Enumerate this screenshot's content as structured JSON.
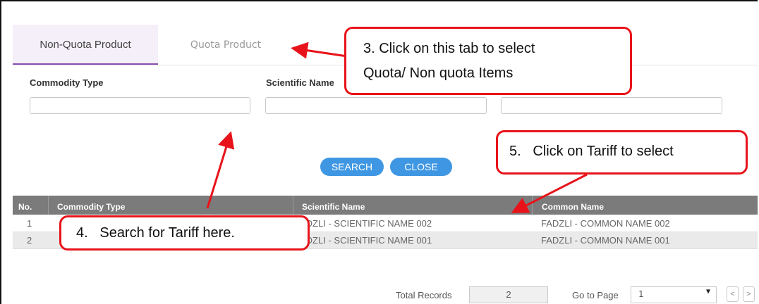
{
  "tabs": [
    {
      "label": "Non-Quota Product",
      "active": true
    },
    {
      "label": "Quota Product",
      "active": false
    }
  ],
  "filters": {
    "commodity_type_label": "Commodity Type",
    "scientific_name_label": "Scientific Name",
    "commodity_type_value": "",
    "scientific_name_value": "",
    "common_name_value": ""
  },
  "buttons": {
    "search": "SEARCH",
    "close": "CLOSE"
  },
  "table": {
    "columns": [
      "No.",
      "Commodity Type",
      "Scientific Name",
      "Common Name"
    ],
    "rows": [
      {
        "no": "1",
        "scientific": "ADZLI - SCIENTIFIC NAME 002",
        "common": "FADZLI - COMMON NAME 002"
      },
      {
        "no": "2",
        "scientific": "ADZLI - SCIENTIFIC NAME 001",
        "common": "FADZLI - COMMON NAME 001"
      }
    ]
  },
  "footer": {
    "total_records_label": "Total Records",
    "total_records_value": "2",
    "go_to_page_label": "Go to Page",
    "page_value": "1",
    "prev_icon": "<",
    "next_icon": ">"
  },
  "callouts": {
    "tab_hint_line1": "3. Click on this tab to select",
    "tab_hint_line2": "Quota/ Non quota Items",
    "tariff_hint": "5.   Click on Tariff to select",
    "search_hint": "4.   Search for Tariff here."
  },
  "colors": {
    "accent": "#3f97e3",
    "tab_underline": "#8a4fb0",
    "callout_border": "#e8131a",
    "header_bg": "#7b7b7b"
  }
}
